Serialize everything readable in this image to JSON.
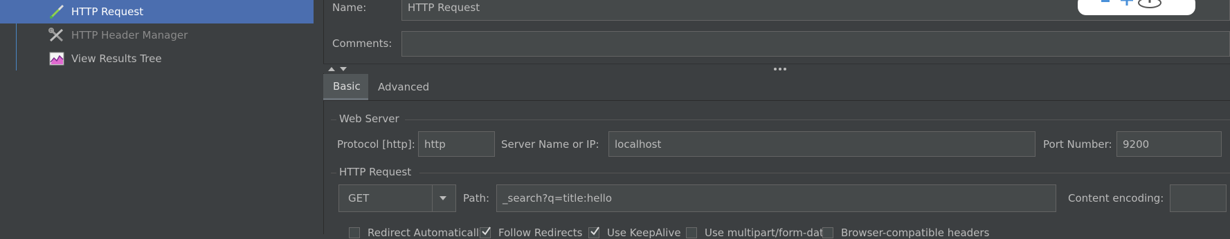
{
  "tree": {
    "items": [
      {
        "label": "HTTP Request",
        "icon": "pipette-icon",
        "selected": true
      },
      {
        "label": "HTTP Header Manager",
        "icon": "wrench-screwdriver-icon",
        "disabled": true
      },
      {
        "label": "View Results Tree",
        "icon": "results-chart-icon"
      }
    ]
  },
  "form": {
    "name_label": "Name:",
    "name_value": "HTTP Request",
    "comments_label": "Comments:",
    "comments_value": ""
  },
  "tabs": [
    {
      "label": "Basic",
      "active": true
    },
    {
      "label": "Advanced"
    }
  ],
  "web_server": {
    "title": "Web Server",
    "protocol_label": "Protocol [http]:",
    "protocol_value": "http",
    "server_label": "Server Name or IP:",
    "server_value": "localhost",
    "port_label": "Port Number:",
    "port_value": "9200"
  },
  "http_request": {
    "title": "HTTP Request",
    "method": "GET",
    "path_label": "Path:",
    "path_value": "_search?q=title:hello",
    "encoding_label": "Content encoding:",
    "encoding_value": ""
  },
  "options": [
    {
      "label": "Redirect Automatically",
      "checked": false
    },
    {
      "label": "Follow Redirects",
      "checked": true
    },
    {
      "label": "Use KeepAlive",
      "checked": true
    },
    {
      "label": "Use multipart/form-data",
      "checked": false
    },
    {
      "label": "Browser-compatible headers",
      "checked": false
    }
  ],
  "colors": {
    "background": "#3c3f41",
    "selection": "#4b6eaf",
    "field": "#45494a",
    "text": "#bbbbbb"
  }
}
